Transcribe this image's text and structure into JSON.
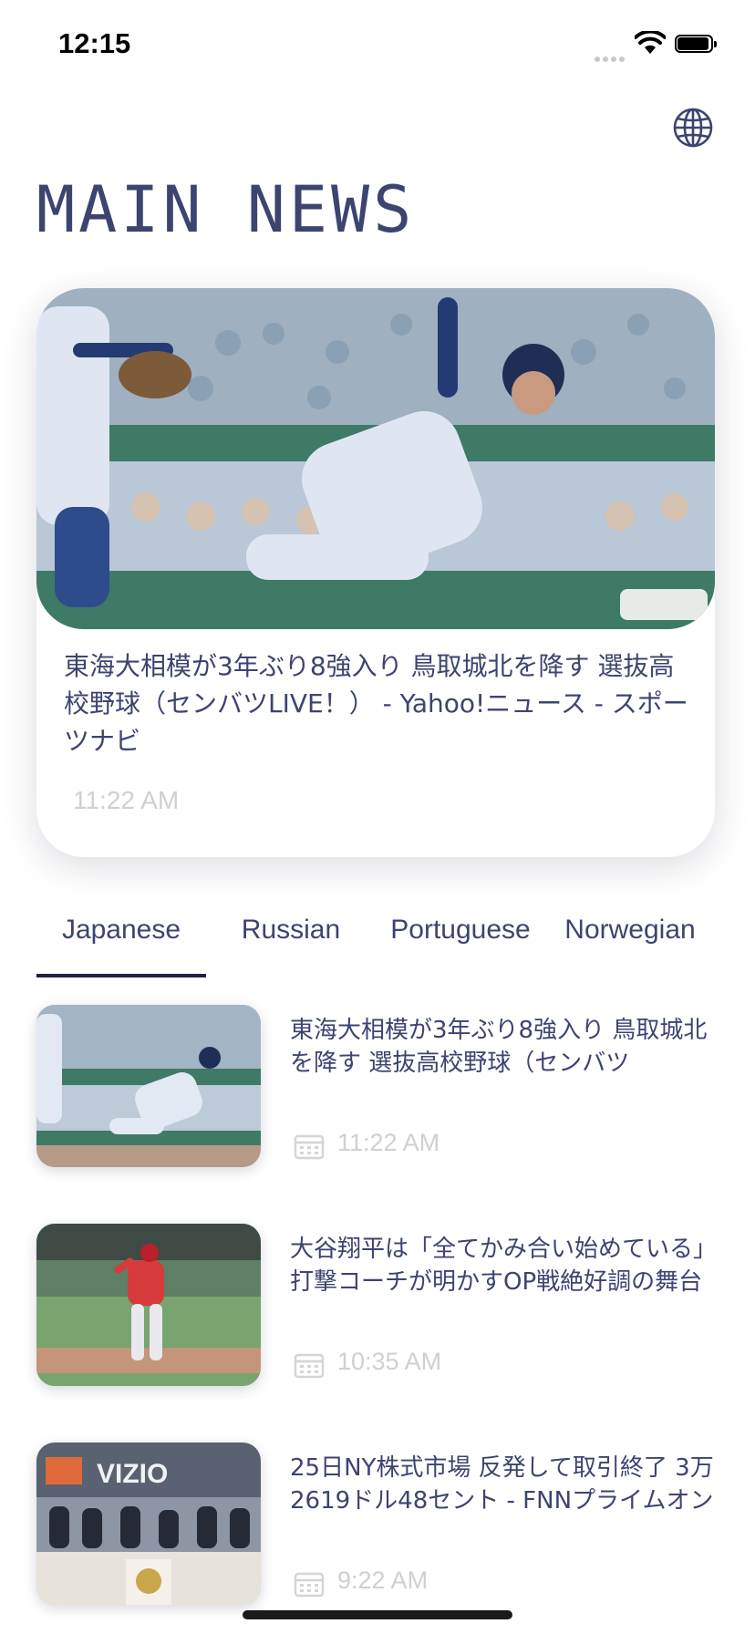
{
  "status_bar": {
    "time": "12:15"
  },
  "header": {
    "title": "MAIN NEWS",
    "language_icon": "globe-icon"
  },
  "featured": {
    "headline": "東海大相模が3年ぶり8強入り 鳥取城北を降す 選抜高校野球（センバツLIVE！） - Yahoo!ニュース - スポーツナビ",
    "time": "11:22 AM"
  },
  "tabs": [
    {
      "label": "Japanese",
      "selected": true
    },
    {
      "label": "Russian",
      "selected": false
    },
    {
      "label": "Portuguese",
      "selected": false
    },
    {
      "label": "Norwegian",
      "selected": false
    }
  ],
  "news_list": [
    {
      "headline": "東海大相模が3年ぶり8強入り 鳥取城北を降す 選抜高校野球（センバツ",
      "time": "11:22 AM",
      "icon": "calendar-icon"
    },
    {
      "headline": "大谷翔平は「全てかみ合い始めている」打撃コーチが明かすOP戦絶好調の舞台",
      "time": "10:35 AM",
      "icon": "calendar-icon"
    },
    {
      "headline": "25日NY株式市場 反発して取引終了 3万2619ドル48セント - FNNプライムオン",
      "time": "9:22 AM",
      "icon": "calendar-icon"
    }
  ],
  "colors": {
    "accent": "#3d4470",
    "muted": "#cfcfd4",
    "tab_indicator": "#1f2340"
  }
}
